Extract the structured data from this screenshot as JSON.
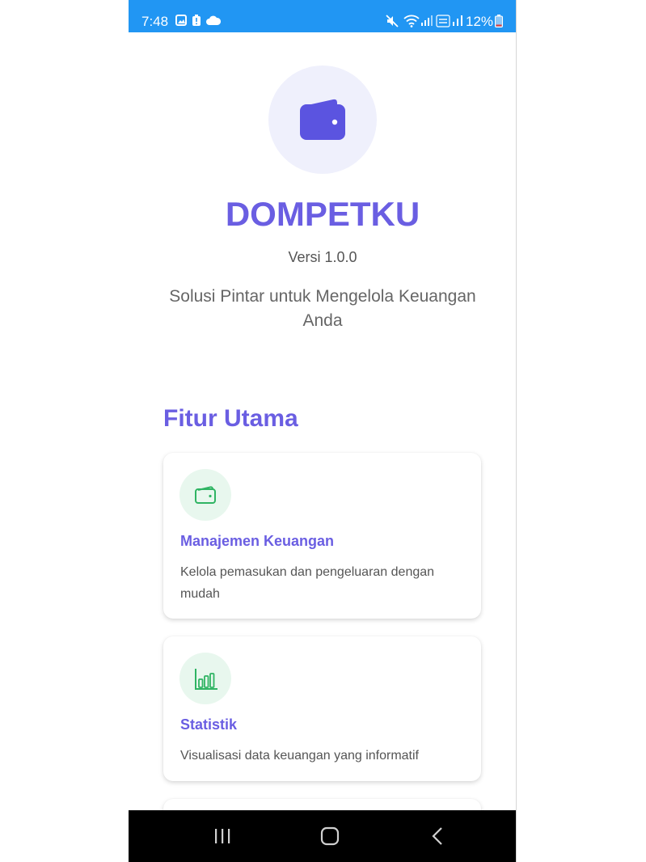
{
  "status_bar": {
    "time": "7:48",
    "battery_percent": "12%",
    "icons": [
      "gallery-icon",
      "battery-alert-icon",
      "cloud-icon",
      "mute-icon",
      "wifi-icon",
      "signal-icon",
      "volte-icon",
      "signal-2-icon",
      "battery-icon"
    ]
  },
  "app": {
    "title": "DOMPETKU",
    "version": "Versi 1.0.0",
    "tagline": "Solusi Pintar untuk Mengelola Keuangan Anda",
    "logo_icon": "wallet-icon"
  },
  "features": {
    "heading": "Fitur Utama",
    "items": [
      {
        "title": "Manajemen Keuangan",
        "description": "Kelola pemasukan dan pengeluaran dengan mudah",
        "icon": "wallet-icon"
      },
      {
        "title": "Statistik",
        "description": "Visualisasi data keuangan yang informatif",
        "icon": "bar-chart-icon"
      }
    ]
  },
  "nav_bar": {
    "buttons": [
      "recent-apps-icon",
      "home-icon",
      "back-icon"
    ]
  },
  "colors": {
    "status_bar": "#2196f3",
    "accent": "#6a5ee2",
    "logo_bg": "#eff0fc",
    "feature_icon": "#2fb463",
    "feature_icon_bg": "#e8f7ee"
  }
}
